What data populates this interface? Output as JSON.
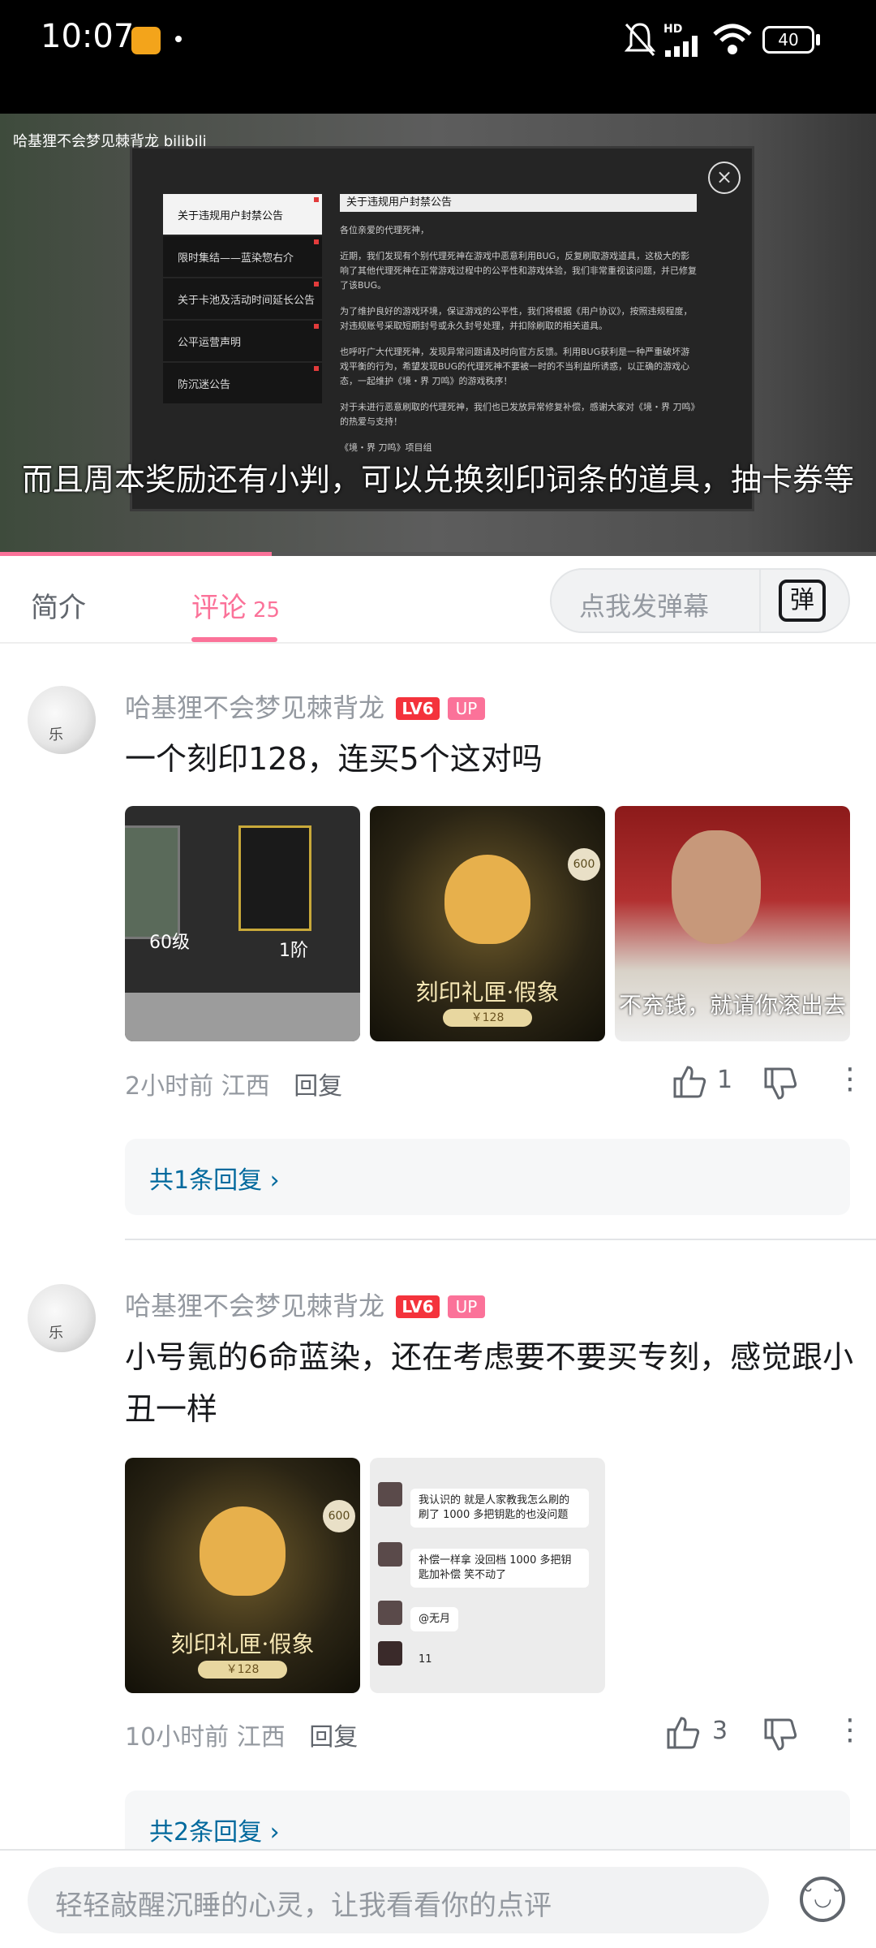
{
  "status_bar": {
    "time": "10:07",
    "battery": "40",
    "network": "HD"
  },
  "video": {
    "watermark": "哈基狸不会梦见棘背龙 bilibili",
    "subtitle": "而且周本奖励还有小判，可以兑换刻印词条的道具，抽卡券等",
    "progress_fraction": 0.31,
    "panel": {
      "menu": [
        "关于违规用户封禁公告",
        "限时集结——蓝染惣右介",
        "关于卡池及活动时间延长公告",
        "公平运营声明",
        "防沉迷公告"
      ],
      "title": "关于违规用户封禁公告",
      "paragraphs": [
        "各位亲爱的代理死神，",
        "近期，我们发现有个别代理死神在游戏中恶意利用BUG，反复刷取游戏道具，这极大的影响了其他代理死神在正常游戏过程中的公平性和游戏体验，我们非常重视该问题，并已修复了该BUG。",
        "为了维护良好的游戏环境，保证游戏的公平性，我们将根据《用户协议》，按照违规程度，对违规账号采取短期封号或永久封号处理，并扣除刷取的相关道具。",
        "也呼吁广大代理死神，发现异常问题请及时向官方反馈。利用BUG获利是一种严重破坏游戏平衡的行为，希望发现BUG的代理死神不要被一时的不当利益所诱惑，以正确的游戏心态，一起维护《境・界 刀鸣》的游戏秩序！",
        "对于未进行恶意刷取的代理死神，我们也已发放异常修复补偿，感谢大家对《境・界 刀鸣》的热爱与支持！",
        "《境・界 刀鸣》项目组"
      ]
    }
  },
  "tabs": {
    "intro": "简介",
    "comments": "评论",
    "comments_count": "25",
    "danmaku_placeholder": "点我发弹幕",
    "danmaku_icon": "弹"
  },
  "comments": [
    {
      "username": "哈基狸不会梦见棘背龙",
      "level": "LV6",
      "up_badge": "UP",
      "avatar_label": "乐",
      "text": "一个刻印128，连买5个这对吗",
      "images": [
        {
          "kind": "game-cards",
          "labels": [
            "60级",
            "1阶"
          ]
        },
        {
          "kind": "gift-box",
          "title": "刻印礼匣·假象",
          "price": "￥128",
          "badge": "600"
        },
        {
          "kind": "meme",
          "caption": "不充钱，就请你滚出去"
        }
      ],
      "time": "2小时前",
      "location": "江西",
      "reply_label": "回复",
      "likes": "1",
      "replies_link": "共1条回复 ›"
    },
    {
      "username": "哈基狸不会梦见棘背龙",
      "level": "LV6",
      "up_badge": "UP",
      "avatar_label": "乐",
      "text": "小号氪的6命蓝染，还在考虑要不要买专刻，感觉跟小丑一样",
      "images": [
        {
          "kind": "gift-box",
          "title": "刻印礼匣·假象",
          "price": "￥128",
          "badge": "600"
        },
        {
          "kind": "chat",
          "lines": [
            "我认识的 就是人家教我怎么刷的 刷了 1000 多把钥匙的也没问题",
            "补偿一样拿 没回档 1000 多把钥匙加补偿 笑不动了",
            "@无月",
            "11"
          ]
        }
      ],
      "time": "10小时前",
      "location": "江西",
      "reply_label": "回复",
      "likes": "3",
      "replies_link": "共2条回复 ›"
    }
  ],
  "bottom_bar": {
    "placeholder": "轻轻敲醒沉睡的心灵，让我看看你的点评",
    "emoji_icon": "emoji-icon"
  },
  "colors": {
    "accent": "#fb7299",
    "link": "#00699d",
    "level_badge": "#f4333c"
  }
}
